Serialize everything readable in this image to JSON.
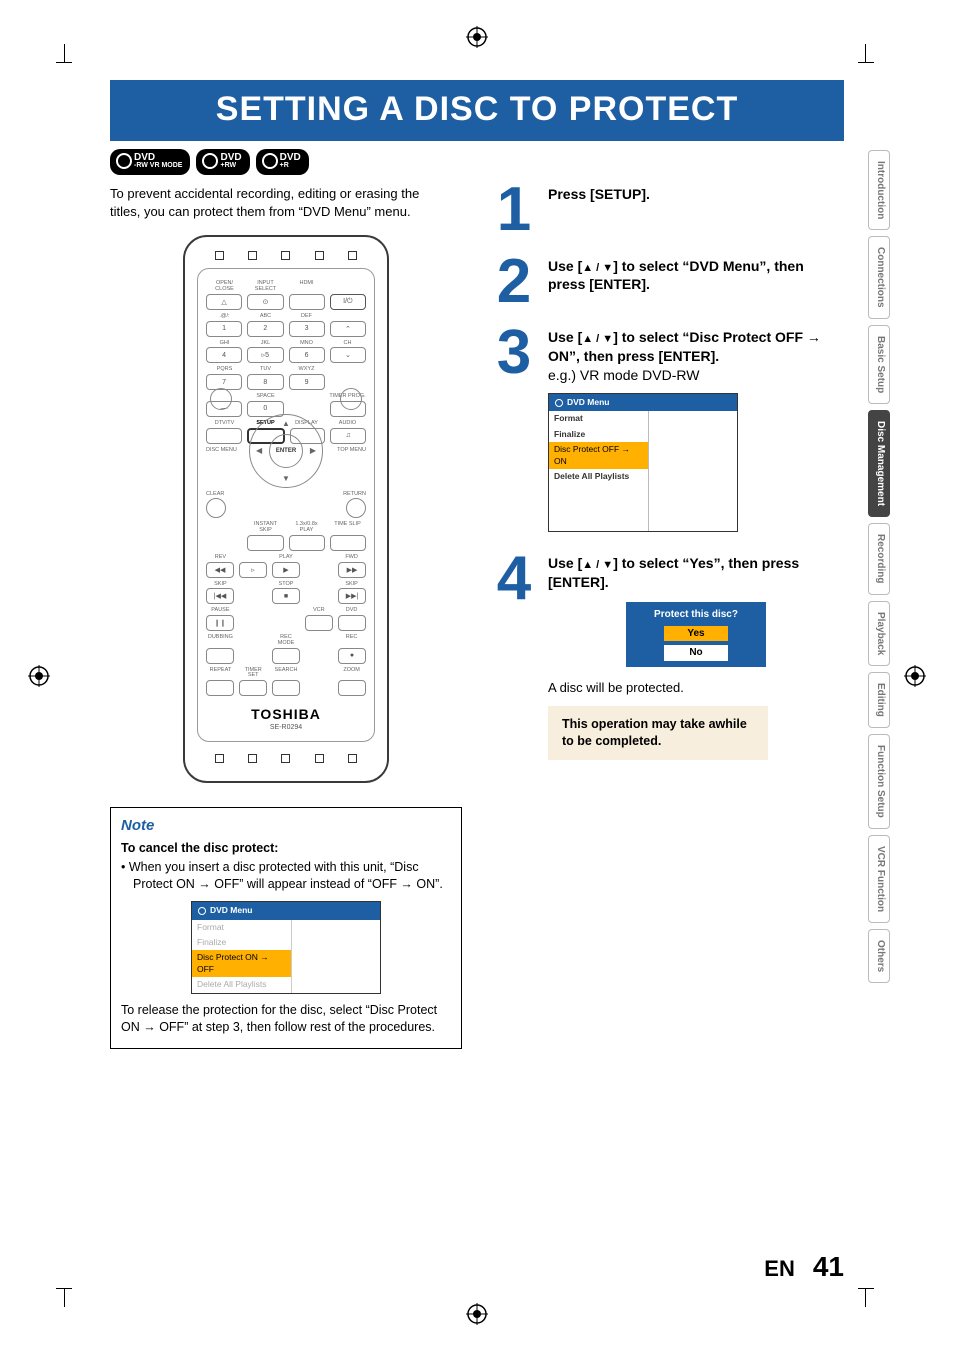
{
  "title": "SETTING A DISC TO PROTECT",
  "badges": [
    {
      "main": "DVD",
      "sub": "-RW VR MODE"
    },
    {
      "main": "DVD",
      "sub": "+RW"
    },
    {
      "main": "DVD",
      "sub": "+R"
    }
  ],
  "intro": "To prevent accidental recording, editing or erasing the titles, you can protect them from “DVD Menu” menu.",
  "remote": {
    "brand": "TOSHIBA",
    "model": "SE-R0294",
    "row1_labels": [
      "OPEN/\nCLOSE",
      "INPUT\nSELECT",
      "HDMI",
      ""
    ],
    "row1_keys": [
      "△",
      "⊙",
      "",
      "I/⏻"
    ],
    "row2_labels": [
      ".@/:",
      "ABC",
      "DEF",
      ""
    ],
    "row2_keys": [
      "1",
      "2",
      "3",
      "⌃"
    ],
    "row3_labels": [
      "GHI",
      "JKL",
      "MNO",
      "CH"
    ],
    "row3_keys": [
      "4",
      "▹5",
      "6",
      "⌄"
    ],
    "row4_labels": [
      "PQRS",
      "TUV",
      "WXYZ",
      ""
    ],
    "row4_keys": [
      "7",
      "8",
      "9",
      ""
    ],
    "row5_labels": [
      "",
      "SPACE",
      "",
      "TIMER\nPROG."
    ],
    "row5_keys": [
      "—",
      "0",
      "",
      ""
    ],
    "row6_labels": [
      "DTV/TV",
      "SETUP",
      "DISPLAY",
      "AUDIO"
    ],
    "row6_keys": [
      "",
      "",
      "",
      "♫"
    ],
    "disc_menu": "DISC MENU",
    "top_menu": "TOP MENU",
    "enter": "ENTER",
    "clear": "CLEAR",
    "return": "RETURN",
    "row7_labels": [
      "",
      "INSTANT\nSKIP",
      "1.3x/0.8x\nPLAY",
      "TIME SLIP"
    ],
    "row8_labels": [
      "REV",
      "",
      "PLAY",
      "",
      "FWD"
    ],
    "row8_keys": [
      "◀◀",
      "▹",
      "▶",
      "",
      "▶▶"
    ],
    "row9_labels": [
      "SKIP",
      "",
      "STOP",
      "",
      "SKIP"
    ],
    "row9_keys": [
      "|◀◀",
      "",
      "■",
      "",
      "▶▶|"
    ],
    "row10_labels": [
      "PAUSE",
      "",
      "",
      "VCR",
      "DVD"
    ],
    "row10_keys": [
      "❙❙",
      "",
      "",
      "",
      ""
    ],
    "row11_labels": [
      "DUBBING",
      "",
      "REC MODE",
      "",
      "REC"
    ],
    "row11_keys": [
      "",
      "",
      "",
      "",
      "●"
    ],
    "row12_labels": [
      "REPEAT",
      "TIMER SET",
      "SEARCH",
      "",
      "ZOOM"
    ]
  },
  "steps": [
    {
      "n": "1",
      "text_a": "Press [SETUP].",
      "text_b": ""
    },
    {
      "n": "2",
      "text_a": "Use [",
      "text_b": "] to select “DVD Menu”, then press [ENTER]."
    },
    {
      "n": "3",
      "text_a": "Use [",
      "text_b": "] to select “Disc Protect OFF → ON”, then press [ENTER].",
      "sub": "e.g.) VR mode DVD-RW"
    },
    {
      "n": "4",
      "text_a": "Use [",
      "text_b": "] to select “Yes”, then press [ENTER]."
    }
  ],
  "dvd_menu_title": "DVD Menu",
  "dvd_menu_items": [
    "Format",
    "Finalize",
    "Disc Protect OFF → ON",
    "Delete All Playlists"
  ],
  "protect_q": "Protect this disc?",
  "protect_yes": "Yes",
  "protect_no": "No",
  "after_protect": "A disc will be protected.",
  "warn": "This operation may take awhile to be completed.",
  "note": {
    "title": "Note",
    "cancel_h": "To cancel the disc protect:",
    "bullet": "When you insert a disc protected with this unit, “Disc Protect ON → OFF” will appear instead of “OFF → ON”.",
    "menu_items": [
      "Format",
      "Finalize",
      "Disc Protect ON → OFF",
      "Delete All Playlists"
    ],
    "release": "To release the protection for the disc, select “Disc Protect ON → OFF” at step 3, then follow rest of the procedures."
  },
  "tabs": [
    "Introduction",
    "Connections",
    "Basic Setup",
    "Disc\nManagement",
    "Recording",
    "Playback",
    "Editing",
    "Function Setup",
    "VCR Function",
    "Others"
  ],
  "active_tab_index": 3,
  "footer": {
    "lang": "EN",
    "page": "41"
  }
}
